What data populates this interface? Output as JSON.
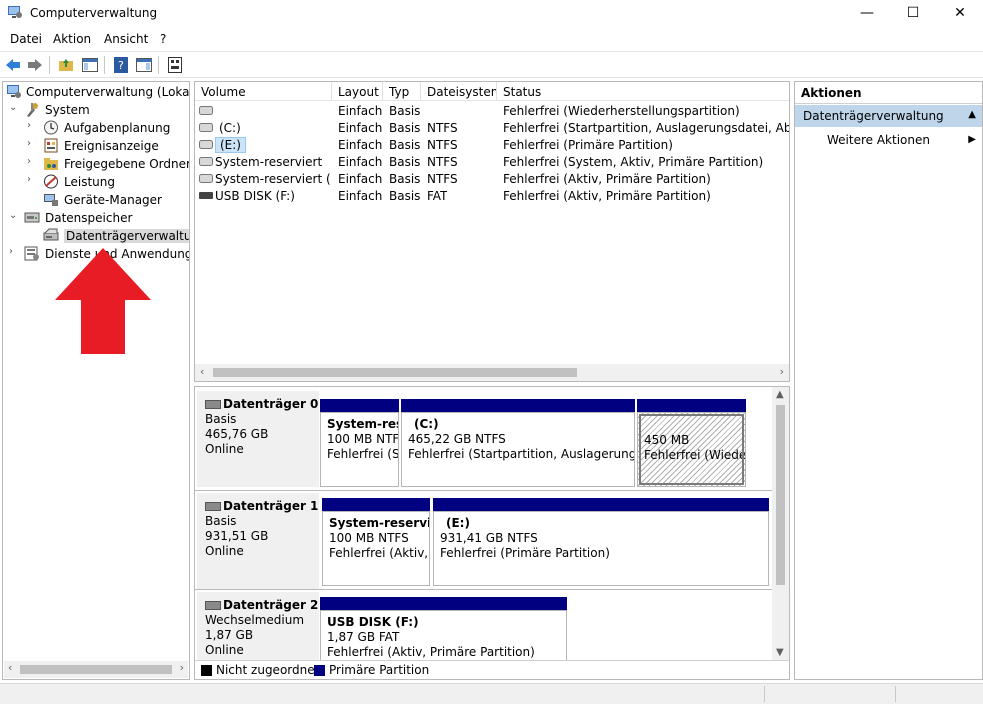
{
  "window": {
    "title": "Computerverwaltung",
    "controls": {
      "minimize": "—",
      "maximize": "☐",
      "close": "✕"
    }
  },
  "menu": [
    "Datei",
    "Aktion",
    "Ansicht",
    "?"
  ],
  "tree": {
    "items": [
      {
        "label": "Computerverwaltung (Lokal)",
        "icon": "computer-management-icon"
      },
      {
        "label": "System",
        "icon": "tools-icon"
      },
      {
        "label": "Aufgabenplanung",
        "icon": "clock-icon"
      },
      {
        "label": "Ereignisanzeige",
        "icon": "event-viewer-icon"
      },
      {
        "label": "Freigegebene Ordner",
        "icon": "shared-folder-icon"
      },
      {
        "label": "Leistung",
        "icon": "performance-icon"
      },
      {
        "label": "Geräte-Manager",
        "icon": "device-manager-icon"
      },
      {
        "label": "Datenspeicher",
        "icon": "storage-icon"
      },
      {
        "label": "Datenträgerverwaltung",
        "icon": "disk-management-icon"
      },
      {
        "label": "Dienste und Anwendungen",
        "icon": "services-icon"
      }
    ]
  },
  "volume_list": {
    "columns": [
      "Volume",
      "Layout",
      "Typ",
      "Dateisystem",
      "Status"
    ],
    "rows": [
      {
        "volume": "",
        "layout": "Einfach",
        "typ": "Basis",
        "fs": "",
        "status": "Fehlerfrei (Wiederherstellungspartition)"
      },
      {
        "volume": "(C:)",
        "layout": "Einfach",
        "typ": "Basis",
        "fs": "NTFS",
        "status": "Fehlerfrei (Startpartition, Auslagerungsdatei, Absturzab"
      },
      {
        "volume": "(E:)",
        "layout": "Einfach",
        "typ": "Basis",
        "fs": "NTFS",
        "status": "Fehlerfrei (Primäre Partition)"
      },
      {
        "volume": "System-reserviert",
        "layout": "Einfach",
        "typ": "Basis",
        "fs": "NTFS",
        "status": "Fehlerfrei (System, Aktiv, Primäre Partition)"
      },
      {
        "volume": "System-reserviert (D:)",
        "layout": "Einfach",
        "typ": "Basis",
        "fs": "NTFS",
        "status": "Fehlerfrei (Aktiv, Primäre Partition)"
      },
      {
        "volume": "USB DISK (F:)",
        "layout": "Einfach",
        "typ": "Basis",
        "fs": "FAT",
        "status": "Fehlerfrei (Aktiv, Primäre Partition)"
      }
    ]
  },
  "disks": [
    {
      "name": "Datenträger 0",
      "type": "Basis",
      "size": "465,76 GB",
      "state": "Online",
      "partitions": [
        {
          "name": "System-rese",
          "size": "100 MB NTFS",
          "status": "Fehlerfrei (Sy"
        },
        {
          "name": "(C:)",
          "size": "465,22 GB NTFS",
          "status": "Fehlerfrei (Startpartition, Auslagerungsdat"
        },
        {
          "name": "",
          "size": "450 MB",
          "status": "Fehlerfrei (Wiederl"
        }
      ]
    },
    {
      "name": "Datenträger 1",
      "type": "Basis",
      "size": "931,51 GB",
      "state": "Online",
      "partitions": [
        {
          "name": "System-reservier",
          "size": "100 MB NTFS",
          "status": "Fehlerfrei (Aktiv, P"
        },
        {
          "name": "(E:)",
          "size": "931,41 GB NTFS",
          "status": "Fehlerfrei (Primäre Partition)"
        }
      ]
    },
    {
      "name": "Datenträger 2",
      "type": "Wechselmedium",
      "size": "1,87 GB",
      "state": "Online",
      "partitions": [
        {
          "name": "USB DISK  (F:)",
          "size": "1,87 GB FAT",
          "status": "Fehlerfrei (Aktiv, Primäre Partition)"
        }
      ]
    }
  ],
  "legend": {
    "unallocated": "Nicht zugeordnet",
    "primary": "Primäre Partition"
  },
  "actions": {
    "header": "Aktionen",
    "section": "Datenträgerverwaltung",
    "more": "Weitere Aktionen"
  },
  "colors": {
    "primary_partition": "#000080",
    "unallocated": "#000000",
    "selection": "#bfd5ea",
    "annotation_arrow": "#e81c24"
  }
}
